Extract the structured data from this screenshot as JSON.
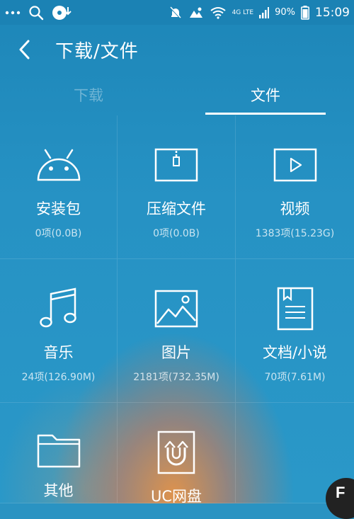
{
  "status_bar": {
    "lte": "4G LTE",
    "battery": "90%",
    "time": "15:09"
  },
  "header": {
    "title": "下载/文件"
  },
  "tabs": [
    {
      "label": "下载",
      "active": false
    },
    {
      "label": "文件",
      "active": true
    }
  ],
  "grid": [
    {
      "label": "安装包",
      "meta": "0项(0.0B)",
      "icon": "android-icon"
    },
    {
      "label": "压缩文件",
      "meta": "0项(0.0B)",
      "icon": "zip-icon"
    },
    {
      "label": "视频",
      "meta": "1383项(15.23G)",
      "icon": "video-icon"
    },
    {
      "label": "音乐",
      "meta": "24项(126.90M)",
      "icon": "music-icon"
    },
    {
      "label": "图片",
      "meta": "2181项(732.35M)",
      "icon": "image-icon"
    },
    {
      "label": "文档/小说",
      "meta": "70项(7.61M)",
      "icon": "document-icon"
    },
    {
      "label": "其他",
      "meta": "",
      "icon": "folder-icon"
    },
    {
      "label": "UC网盘",
      "meta": "",
      "icon": "uc-cloud-icon"
    },
    {
      "label": "",
      "meta": "",
      "icon": ""
    }
  ],
  "colors": {
    "accent_bg": "#2a93c2",
    "status_bg": "#1b82b4"
  }
}
